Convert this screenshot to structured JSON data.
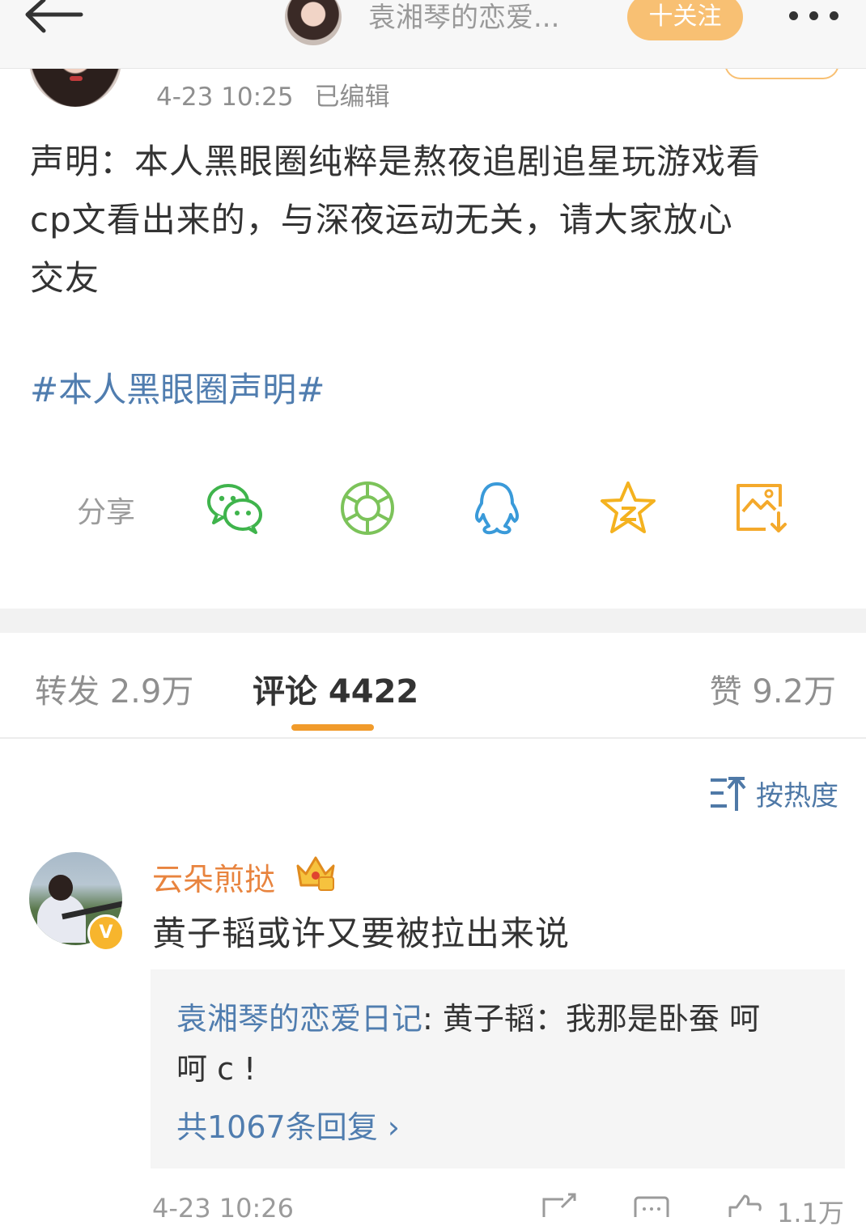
{
  "header": {
    "title": "袁湘琴的恋爱...",
    "follow_label": "十关注"
  },
  "post": {
    "time": "4-23 10:25",
    "edited_label": "已编辑",
    "text_lines": [
      "声明：本人黑眼圈纯粹是熬夜追剧追星玩游戏看",
      "cp文看出来的，与深夜运动无关，请大家放心",
      "交友"
    ],
    "hashtag": "#本人黑眼圈声明#"
  },
  "share": {
    "label": "分享",
    "icons": [
      "wechat-icon",
      "moments-icon",
      "qq-icon",
      "qzone-icon",
      "save-image-icon"
    ]
  },
  "tabs": {
    "repost": "转发 2.9万",
    "comment": "评论 4422",
    "like": "赞 9.2万"
  },
  "sort_label": "按热度",
  "comment": {
    "user": "云朵煎挞",
    "text": "黄子韬或许又要被拉出来说",
    "reply": {
      "user": "袁湘琴的恋爱日记",
      "text_line1": ": 黄子韬：我那是卧蚕 呵",
      "text_line2": "呵 c !",
      "more_label": "共1067条回复 ›"
    },
    "time": "4-23 10:26",
    "like_count": "1.1万"
  },
  "colors": {
    "accent_orange": "#f19b2b",
    "link_blue": "#507daf",
    "follow_button": "#f8c073",
    "username_orange": "#e8843f"
  }
}
